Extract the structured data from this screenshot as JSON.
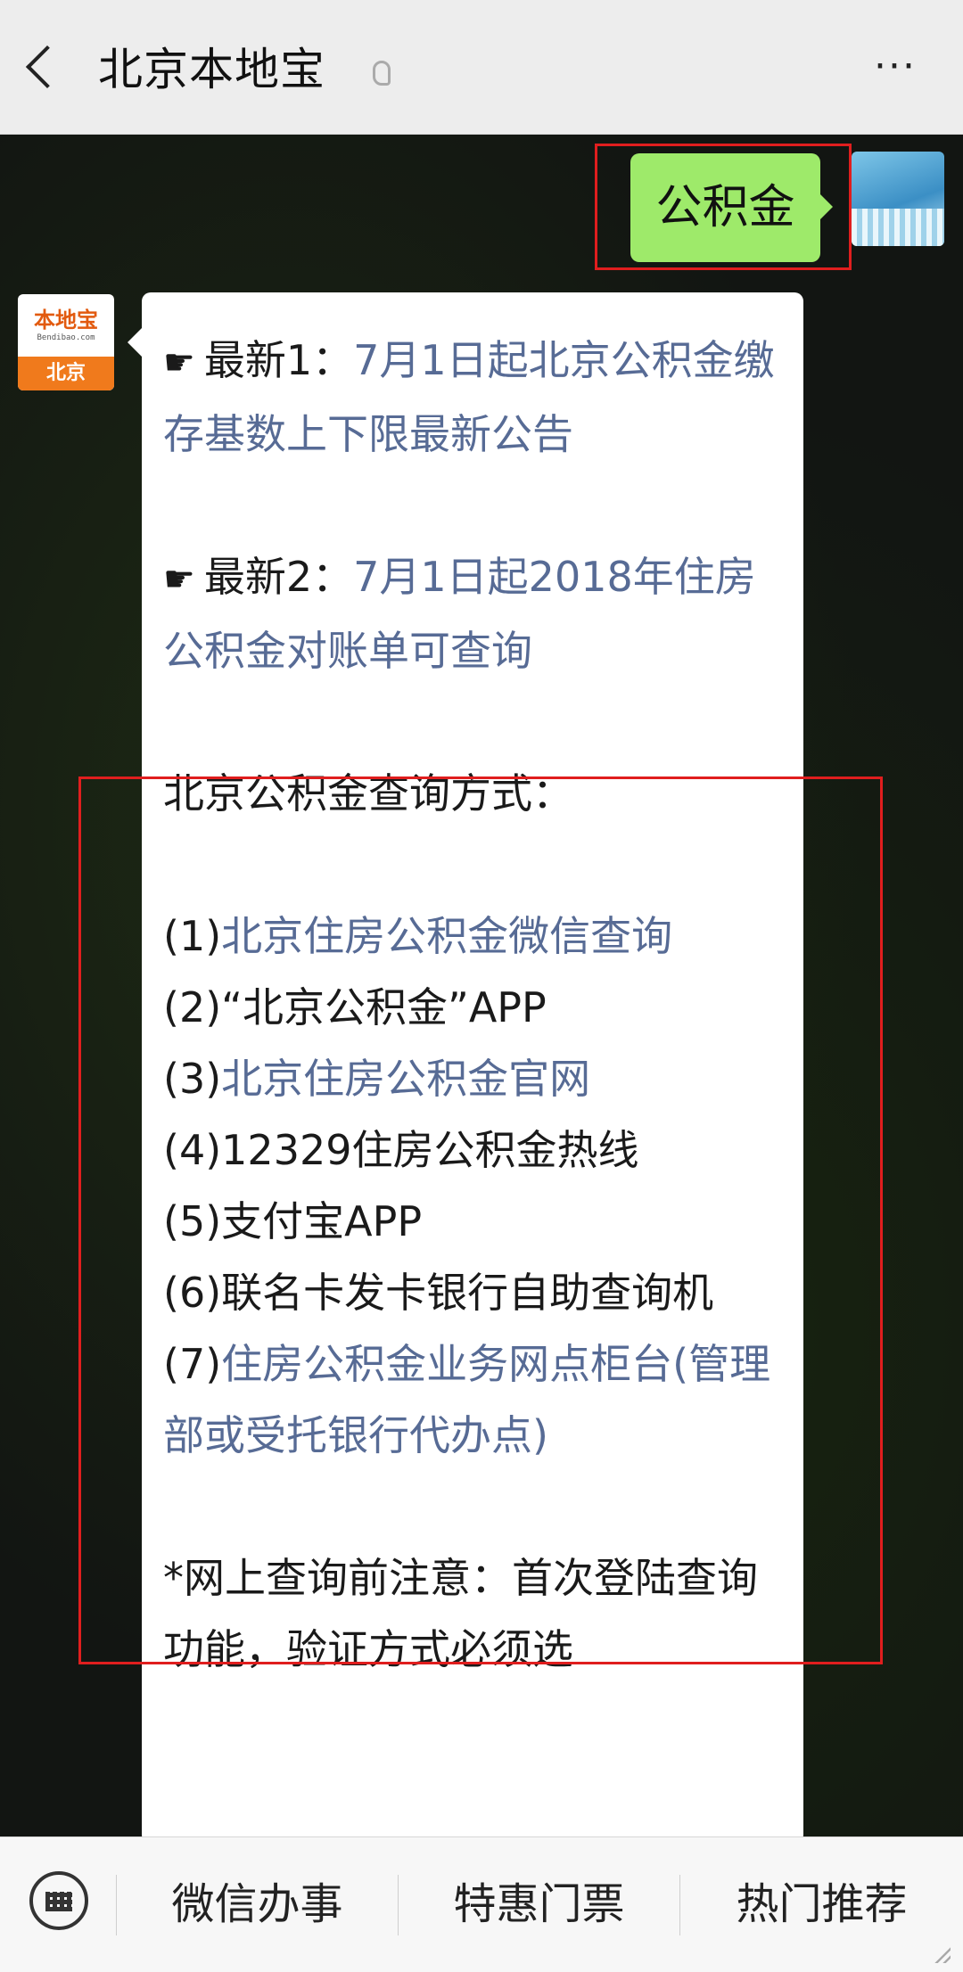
{
  "header": {
    "title": "北京本地宝",
    "icons": {
      "back": "chevron-left-icon",
      "listen": "ear-icon",
      "more": "more-dots-icon"
    },
    "more_label": "···"
  },
  "sent": {
    "text": "公积金"
  },
  "bot": {
    "avatar_logo": "本地宝",
    "avatar_url": "Bendibao.com",
    "avatar_city": "北京"
  },
  "message": {
    "hand": "☛",
    "latest1_label": "最新1：",
    "latest1_link": "7月1日起北京公积金缴存基数上下限最新公告",
    "latest2_label": "最新2：",
    "latest2_link": "7月1日起2018年住房公积金对账单可查询",
    "methods_title": "北京公积金查询方式：",
    "m1_num": "(1)",
    "m1_link": "北京住房公积金微信查询",
    "m2": "(2)“北京公积金”APP",
    "m3_num": "(3)",
    "m3_link": "北京住房公积金官网",
    "m4": "(4)12329住房公积金热线",
    "m5": "(5)支付宝APP",
    "m6": "(6)联名卡发卡银行自助查询机",
    "m7_num": "(7)",
    "m7_link": "住房公积金业务网点柜台(管理部或受托银行代办点)",
    "note": "*网上查询前注意：首次登陆查询功能，验证方式必须选"
  },
  "menu": {
    "items": [
      "微信办事",
      "特惠门票",
      "热门推荐"
    ],
    "keyboard_icon": "keyboard-icon"
  },
  "colors": {
    "sent_bubble": "#9eea6a",
    "link": "#576b95",
    "highlight_box": "#e01e1e"
  }
}
